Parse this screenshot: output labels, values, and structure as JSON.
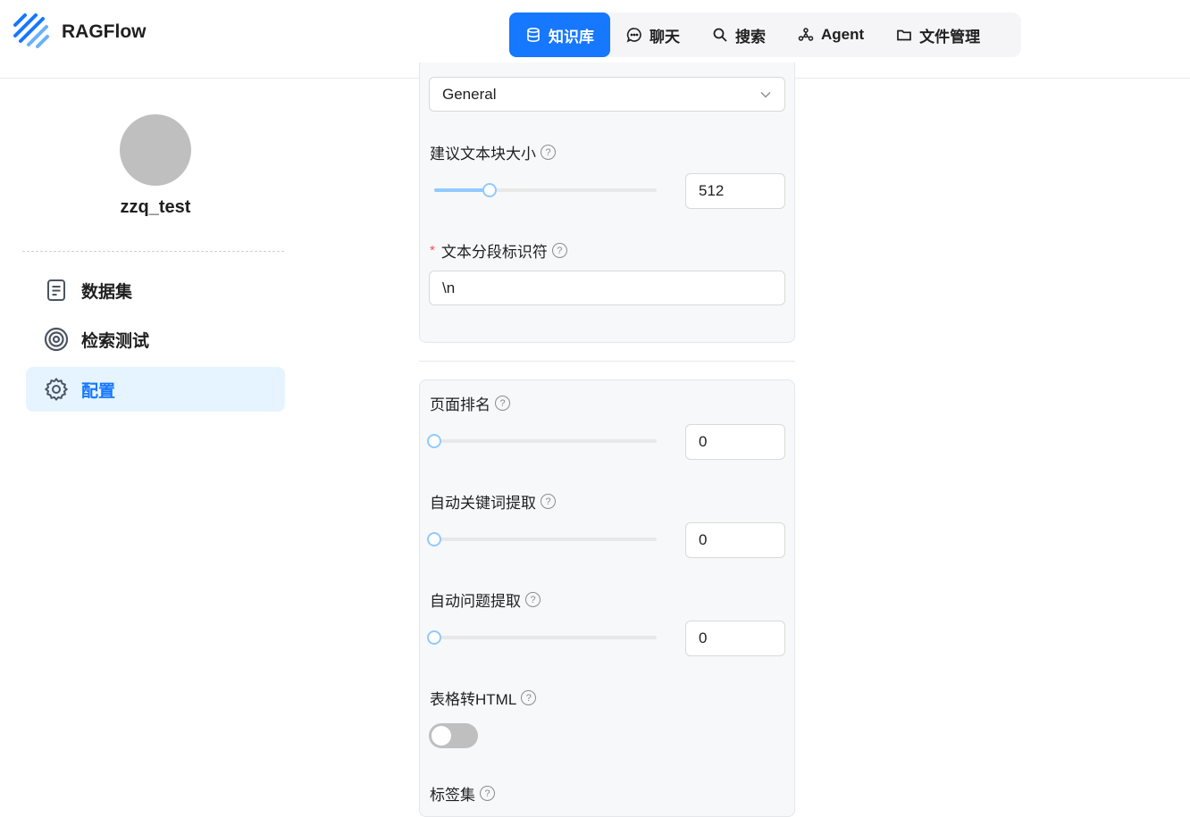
{
  "app": {
    "brand": "RAGFlow"
  },
  "nav": {
    "items": [
      {
        "label": "知识库",
        "icon": "database-icon",
        "active": true
      },
      {
        "label": "聊天",
        "icon": "chat-icon"
      },
      {
        "label": "搜索",
        "icon": "search-icon"
      },
      {
        "label": "Agent",
        "icon": "agent-icon"
      },
      {
        "label": "文件管理",
        "icon": "folder-icon"
      }
    ]
  },
  "sidebar": {
    "kb_name": "zzq_test",
    "items": [
      {
        "label": "数据集",
        "icon": "document-icon"
      },
      {
        "label": "检索测试",
        "icon": "target-icon"
      },
      {
        "label": "配置",
        "icon": "gear-icon",
        "active": true
      }
    ]
  },
  "form": {
    "parser_select": {
      "value": "General"
    },
    "chunk_size": {
      "label": "建议文本块大小",
      "value": "512",
      "fraction": 0.25
    },
    "delimiter": {
      "label": "文本分段标识符",
      "value": "\\n",
      "required": true
    },
    "page_rank": {
      "label": "页面排名",
      "value": "0",
      "fraction": 0
    },
    "auto_keywords": {
      "label": "自动关键词提取",
      "value": "0",
      "fraction": 0
    },
    "auto_questions": {
      "label": "自动问题提取",
      "value": "0",
      "fraction": 0
    },
    "html4excel": {
      "label": "表格转HTML",
      "enabled": false
    },
    "tag_sets": {
      "label": "标签集"
    }
  },
  "colors": {
    "accent": "#1677ff",
    "slider": "#91caff",
    "active_bg": "#e6f4ff"
  }
}
